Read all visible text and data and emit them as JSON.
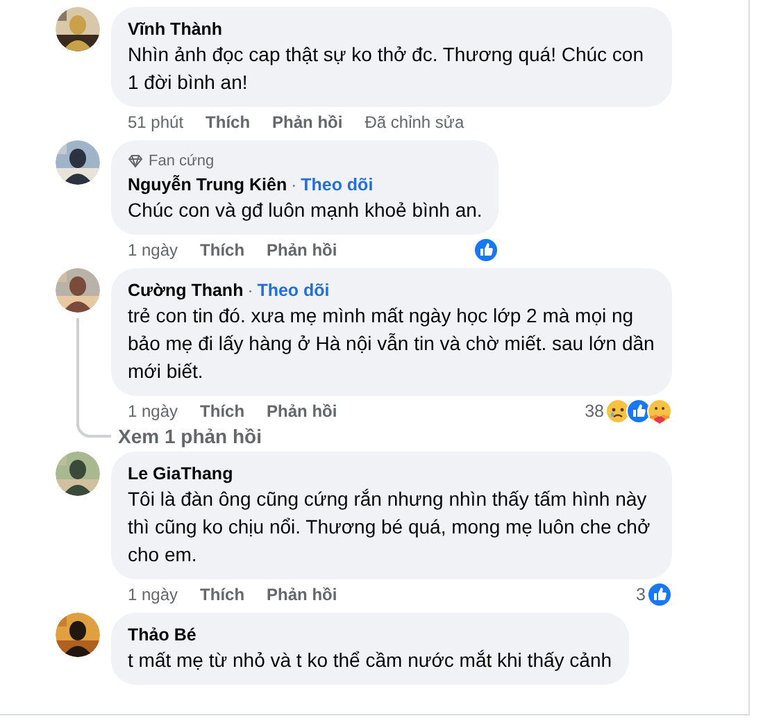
{
  "comments": [
    {
      "author": "Vĩnh Thành",
      "text": "Nhìn ảnh đọc cap thật sự ko thở đc. Thương quá! Chúc con 1 đời bình an!",
      "time": "51 phút",
      "like": "Thích",
      "reply": "Phản hồi",
      "edited": "Đã chỉnh sửa"
    },
    {
      "badge": "Fan cứng",
      "author": "Nguyễn Trung Kiên",
      "separator": "·",
      "follow": "Theo dõi",
      "text": "Chúc con và gđ luôn mạnh khoẻ bình an.",
      "time": "1 ngày",
      "like": "Thích",
      "reply": "Phản hồi",
      "reactions": {
        "icons": [
          {
            "kind": "like"
          }
        ]
      }
    },
    {
      "author": "Cường Thanh",
      "separator": "·",
      "follow": "Theo dõi",
      "text": "trẻ con tin đó. xưa mẹ mình mất ngày học lớp 2 mà mọi ng bảo mẹ đi lấy hàng ở Hà nội vẫn tin và chờ miết. sau lớn dần mới biết.",
      "time": "1 ngày",
      "like": "Thích",
      "reply": "Phản hồi",
      "reactions": {
        "count": "38",
        "icons": [
          {
            "kind": "sad"
          },
          {
            "kind": "like"
          },
          {
            "kind": "care"
          }
        ]
      },
      "view_replies": "Xem 1 phản hồi"
    },
    {
      "author": "Le GiaThang",
      "text": "Tôi là đàn ông cũng cứng rắn nhưng nhìn thấy tấm hình này thì cũng ko chịu nổi. Thương bé quá, mong mẹ luôn che chở cho em.",
      "time": "1 ngày",
      "like": "Thích",
      "reply": "Phản hồi",
      "reactions": {
        "count": "3",
        "icons": [
          {
            "kind": "like"
          }
        ]
      }
    },
    {
      "author": "Thảo Bé",
      "text": "t mất mẹ từ nhỏ và t ko thể cầm nước mắt khi thấy cảnh"
    }
  ]
}
